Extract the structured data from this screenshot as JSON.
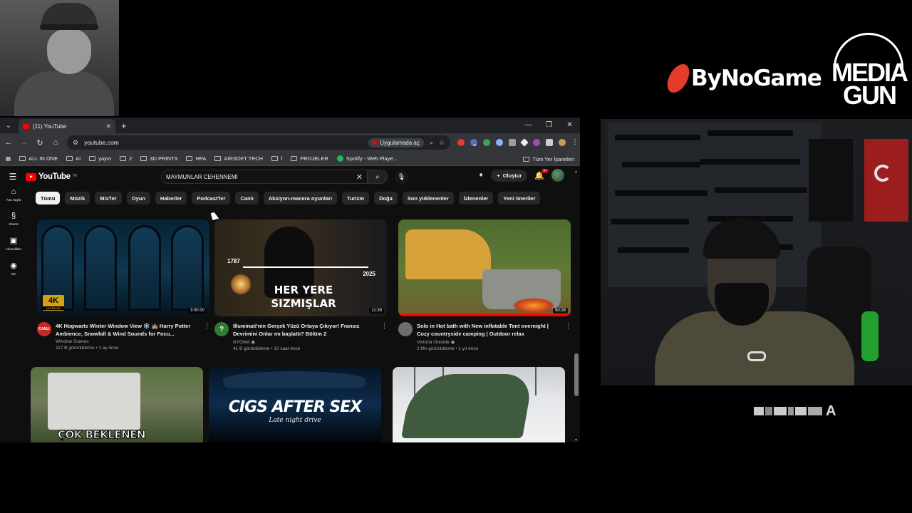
{
  "overlay": {
    "bynogame_logo": "ByNoGame",
    "mediagun_line1": "MEDIA",
    "mediagun_line2": "GUN",
    "glitch_text": "A"
  },
  "browser": {
    "tab_title": "(11) YouTube",
    "url": "youtube.com",
    "open_in_app": "Uygulamada aç",
    "extension_badge": "12",
    "bookmarks": [
      "ALL IN ONE",
      "AI",
      "yayın",
      "2",
      "3D PRINTS",
      "HPA",
      "AIRSOFT TECH",
      "f",
      "PROJELER",
      "Spotify - Web Playe..."
    ],
    "all_bookmarks": "Tüm Yer İşaretleri"
  },
  "youtube": {
    "logo": "YouTube",
    "region": "TR",
    "search_value": "MAYMUNLAR CEHENNEMİ",
    "create_label": "Oluştur",
    "notif_count": "9+",
    "guide": [
      {
        "icon": "⌂",
        "label": "Ana Sayfa"
      },
      {
        "icon": "§",
        "label": "Shorts"
      },
      {
        "icon": "▣",
        "label": "Abonelikler"
      },
      {
        "icon": "◉",
        "label": "Siz"
      }
    ],
    "chips": [
      "Tümü",
      "Müzik",
      "Mix'ler",
      "Oyun",
      "Haberler",
      "Podcast'ler",
      "Canlı",
      "Aksiyon-macera oyunları",
      "Turizm",
      "Doğa",
      "Son yüklenenler",
      "İzlenenler",
      "Yeni öneriler"
    ],
    "videos": [
      {
        "title": "4K Hogwarts Winter Window View ❄️ 🏰 Harry Potter Ambience, Snowfall & Wind Sounds for Focu...",
        "channel": "Window Scenes",
        "stats": "117 B görüntüleme • 1 ay önce",
        "duration": "3:00:00",
        "avatar_text": "CANLI",
        "badge_main": "4K",
        "badge_sub": "ULTRA HD"
      },
      {
        "title": "Illuminati'nin Gerçek Yüzü Ortaya Çıkıyor! Fransız Devrimini Onlar mı başlattı? Bölüm 2",
        "channel": "NYGMA",
        "stats": "41 B görüntüleme • 10 saat önce",
        "duration": "11:39",
        "avatar_text": "?",
        "year_start": "1787",
        "year_end": "2025",
        "thumb_text": "HER YERE SIZMIŞLAR"
      },
      {
        "title": "Solo in Hot bath with New inflatable Tent overnight | Cozy countryside camping | Outdoor relax",
        "channel": "Victoria Outside",
        "stats": "2 Mn görüntüleme • 1 yıl önce",
        "duration": "50:28",
        "avatar_text": ""
      }
    ],
    "videos_row2": [
      {
        "thumb_text": "ÇOK BEKLENEN"
      },
      {
        "thumb_text": "CIGS AFTER SEX",
        "thumb_sub": "Late night drive"
      },
      {
        "thumb_text": ""
      }
    ]
  },
  "colors": {
    "yt_red": "#ff0000",
    "bg": "#0f0f0f",
    "chip_bg": "#272727"
  }
}
